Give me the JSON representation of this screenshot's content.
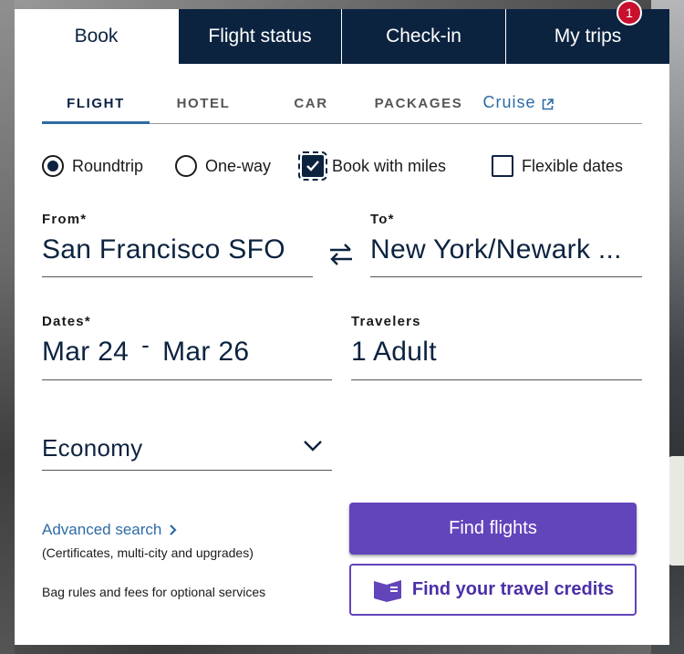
{
  "top_tabs": [
    {
      "label": "Book",
      "active": true
    },
    {
      "label": "Flight status",
      "active": false
    },
    {
      "label": "Check-in",
      "active": false
    },
    {
      "label": "My trips",
      "active": false,
      "badge": "1"
    }
  ],
  "sub_tabs": [
    {
      "label": "FLIGHT",
      "active": true
    },
    {
      "label": "HOTEL",
      "active": false
    },
    {
      "label": "CAR",
      "active": false
    },
    {
      "label": "PACKAGES",
      "active": false
    },
    {
      "label": "Cruise",
      "active": false,
      "icon": "external-link-icon"
    }
  ],
  "trip_options": {
    "roundtrip": {
      "label": "Roundtrip",
      "selected": true
    },
    "oneway": {
      "label": "One-way",
      "selected": false
    },
    "miles": {
      "label": "Book with miles",
      "checked": true
    },
    "flexible": {
      "label": "Flexible dates",
      "checked": false
    }
  },
  "from": {
    "label": "From*",
    "value": "San Francisco SFO"
  },
  "to": {
    "label": "To*",
    "value": "New York/Newark ..."
  },
  "dates": {
    "label": "Dates*",
    "start": "Mar 24",
    "separator": "-",
    "end": "Mar 26"
  },
  "travelers": {
    "label": "Travelers",
    "value": "1 Adult"
  },
  "cabin": {
    "value": "Economy",
    "icon": "chevron-down-icon"
  },
  "advanced_search": {
    "label": "Advanced search",
    "sublabel": "(Certificates, multi-city and upgrades)"
  },
  "bag_rules": {
    "label": "Bag rules and fees for optional services"
  },
  "buttons": {
    "find_flights": "Find flights",
    "travel_credits": "Find your travel credits"
  },
  "colors": {
    "navy": "#0c2340",
    "accent_blue": "#2d6ba6",
    "purple": "#6244bb",
    "badge_red": "#c8102e"
  }
}
